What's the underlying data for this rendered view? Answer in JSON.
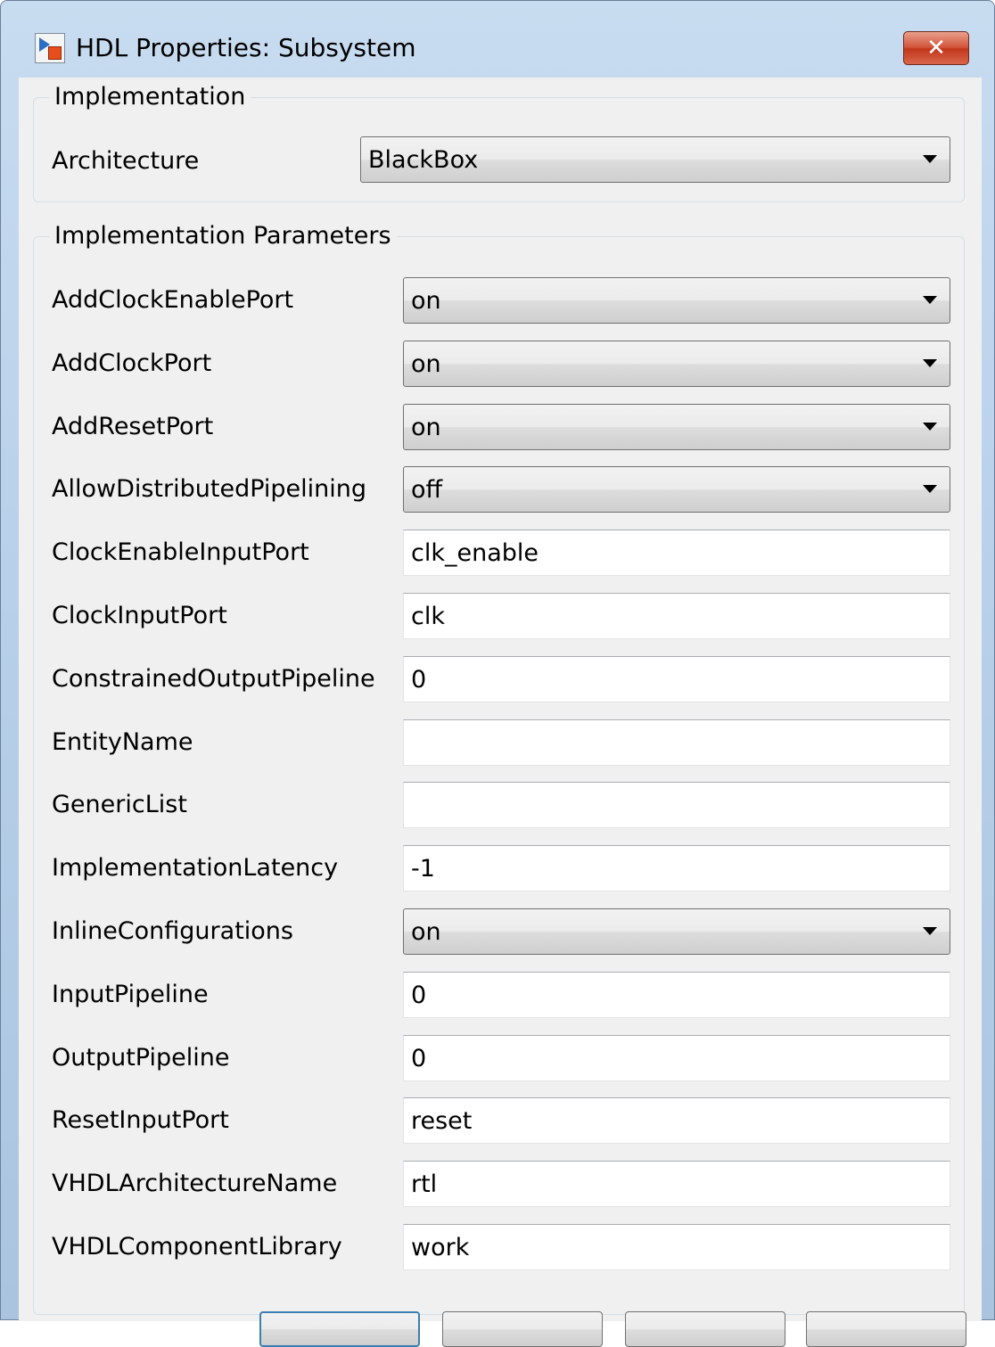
{
  "window": {
    "title": "HDL Properties: Subsystem",
    "close_label": "✕"
  },
  "implementation": {
    "group_title": "Implementation",
    "architecture": {
      "label": "Architecture",
      "value": "BlackBox"
    }
  },
  "parameters": {
    "group_title": "Implementation Parameters",
    "rows": [
      {
        "label": "AddClockEnablePort",
        "value": "on",
        "kind": "combo"
      },
      {
        "label": "AddClockPort",
        "value": "on",
        "kind": "combo"
      },
      {
        "label": "AddResetPort",
        "value": "on",
        "kind": "combo"
      },
      {
        "label": "AllowDistributedPipelining",
        "value": "off",
        "kind": "combo"
      },
      {
        "label": "ClockEnableInputPort",
        "value": "clk_enable",
        "kind": "text"
      },
      {
        "label": "ClockInputPort",
        "value": "clk",
        "kind": "text"
      },
      {
        "label": "ConstrainedOutputPipeline",
        "value": "0",
        "kind": "text"
      },
      {
        "label": "EntityName",
        "value": "",
        "kind": "text"
      },
      {
        "label": "GenericList",
        "value": "",
        "kind": "text"
      },
      {
        "label": "ImplementationLatency",
        "value": "-1",
        "kind": "text"
      },
      {
        "label": "InlineConfigurations",
        "value": "on",
        "kind": "combo"
      },
      {
        "label": "InputPipeline",
        "value": "0",
        "kind": "text"
      },
      {
        "label": "OutputPipeline",
        "value": "0",
        "kind": "text"
      },
      {
        "label": "ResetInputPort",
        "value": "reset",
        "kind": "text"
      },
      {
        "label": "VHDLArchitectureName",
        "value": "rtl",
        "kind": "text"
      },
      {
        "label": "VHDLComponentLibrary",
        "value": "work",
        "kind": "text"
      }
    ]
  },
  "colors": {
    "title_gradient_top": "#c8dcf0",
    "close_button": "#c2371c",
    "default_button_border": "#3c7fb1",
    "dialog_face": "#f0f0f0"
  }
}
